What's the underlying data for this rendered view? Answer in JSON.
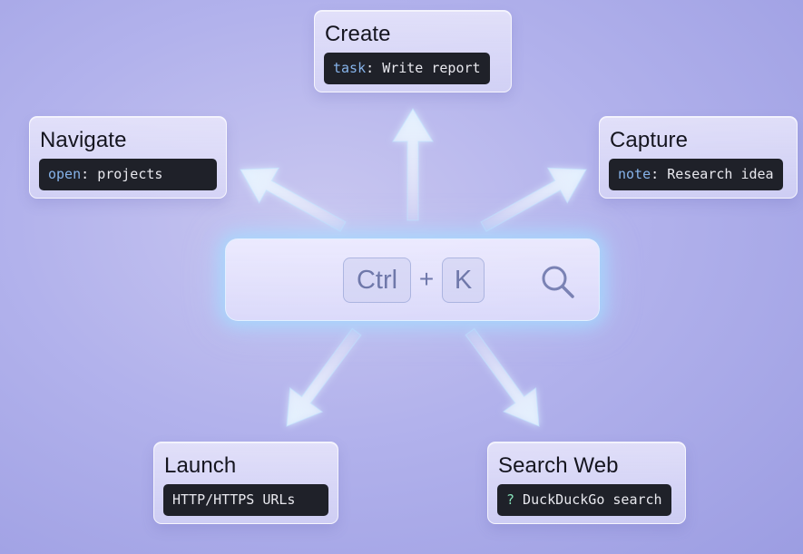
{
  "center": {
    "key1": "Ctrl",
    "plus": "+",
    "key2": "K",
    "icon": "search-icon"
  },
  "cards": {
    "create": {
      "title": "Create",
      "keyword": "task",
      "sep": ": ",
      "rest": "Write report"
    },
    "navigate": {
      "title": "Navigate",
      "keyword": "open",
      "sep": ": ",
      "rest": "projects"
    },
    "capture": {
      "title": "Capture",
      "keyword": "note",
      "sep": ": ",
      "rest": "Research idea"
    },
    "launch": {
      "title": "Launch",
      "text": "HTTP/HTTPS URLs"
    },
    "search": {
      "title": "Search Web",
      "prefix": "?",
      "rest": " DuckDuckGo search"
    }
  },
  "colors": {
    "keyword": "#86b3ea",
    "prefix": "#86e0b8",
    "command_bg": "#1f2129"
  }
}
